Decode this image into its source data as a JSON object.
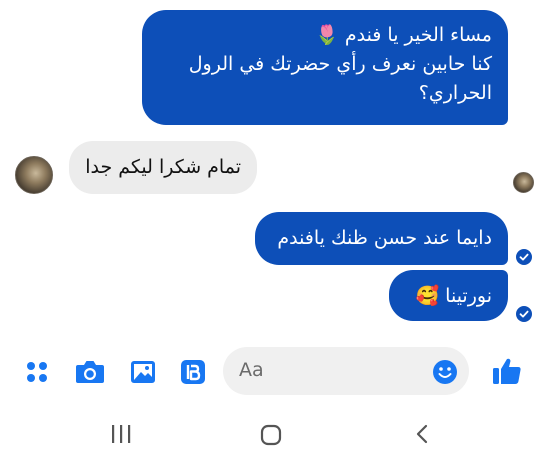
{
  "messages": [
    {
      "direction": "outgoing",
      "text": "مساء الخير يا فندم 🌷\nكنا حابين نعرف رأي حضرتك في الرول الحراري؟"
    },
    {
      "direction": "incoming",
      "text": "تمام شكرا ليكم جدا"
    },
    {
      "direction": "outgoing",
      "text": "دايما عند حسن ظنك يافندم"
    },
    {
      "direction": "outgoing",
      "text": "نورتينا 🥰"
    }
  ],
  "composer": {
    "placeholder": "Aa"
  },
  "icons": {
    "toolbar": [
      "grid-icon",
      "camera-icon",
      "gallery-icon",
      "sticker-icon",
      "emoji-icon",
      "like-icon"
    ],
    "navigation": [
      "recent-apps-icon",
      "home-icon",
      "back-icon"
    ]
  },
  "colors": {
    "outgoing_bubble": "#0d4fb8",
    "incoming_bubble": "#ececec",
    "accent": "#1877f2"
  }
}
